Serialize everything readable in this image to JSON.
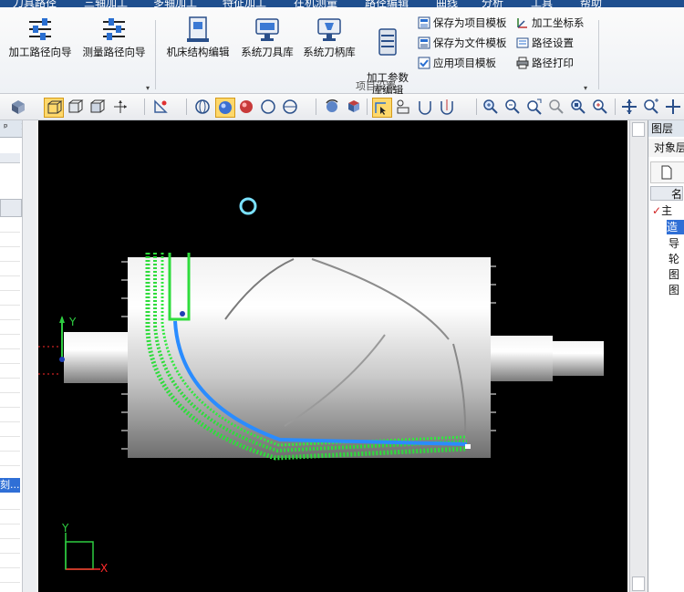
{
  "menu": [
    "刀具路径",
    "三轴加工",
    "多轴加工",
    "特征加工",
    "在机测量",
    "路径编辑",
    "曲线",
    "分析",
    "工具",
    "帮助"
  ],
  "ribbon": {
    "big_buttons": [
      {
        "label": "加工路径向导"
      },
      {
        "label": "测量路径向导"
      },
      {
        "label": "机床结构编辑"
      },
      {
        "label": "系统刀具库"
      },
      {
        "label": "系统刀柄库"
      },
      {
        "label": "加工参数\n库编辑"
      }
    ],
    "small_buttons": [
      {
        "label": "保存为项目模板",
        "icon": "save-template-icon"
      },
      {
        "label": "保存为文件模板",
        "icon": "save-file-template-icon"
      },
      {
        "label": "应用项目模板",
        "icon": "apply-template-icon"
      },
      {
        "label": "加工坐标系",
        "icon": "coordinate-system-icon"
      },
      {
        "label": "路径设置",
        "icon": "path-settings-icon"
      },
      {
        "label": "路径打印",
        "icon": "print-icon"
      }
    ],
    "group_label": "项目设置"
  },
  "left_panel": {
    "close": "×",
    "pin": "ᵖ",
    "selected_text": "刻..."
  },
  "layer_panel": {
    "title": "图层",
    "subtitle": "对象层",
    "col_header": "名",
    "rows": [
      "主",
      "造",
      "导",
      "轮",
      "图",
      "图"
    ]
  },
  "viewport": {
    "axis_labels": {
      "x": "X",
      "y": "Y",
      "y2": "Y"
    },
    "colors": {
      "background": "#000000",
      "path_green": "#2fdc3c",
      "path_blue": "#2a8cff",
      "axis_green": "#2ecc40",
      "axis_red": "#ff2a2a"
    }
  }
}
